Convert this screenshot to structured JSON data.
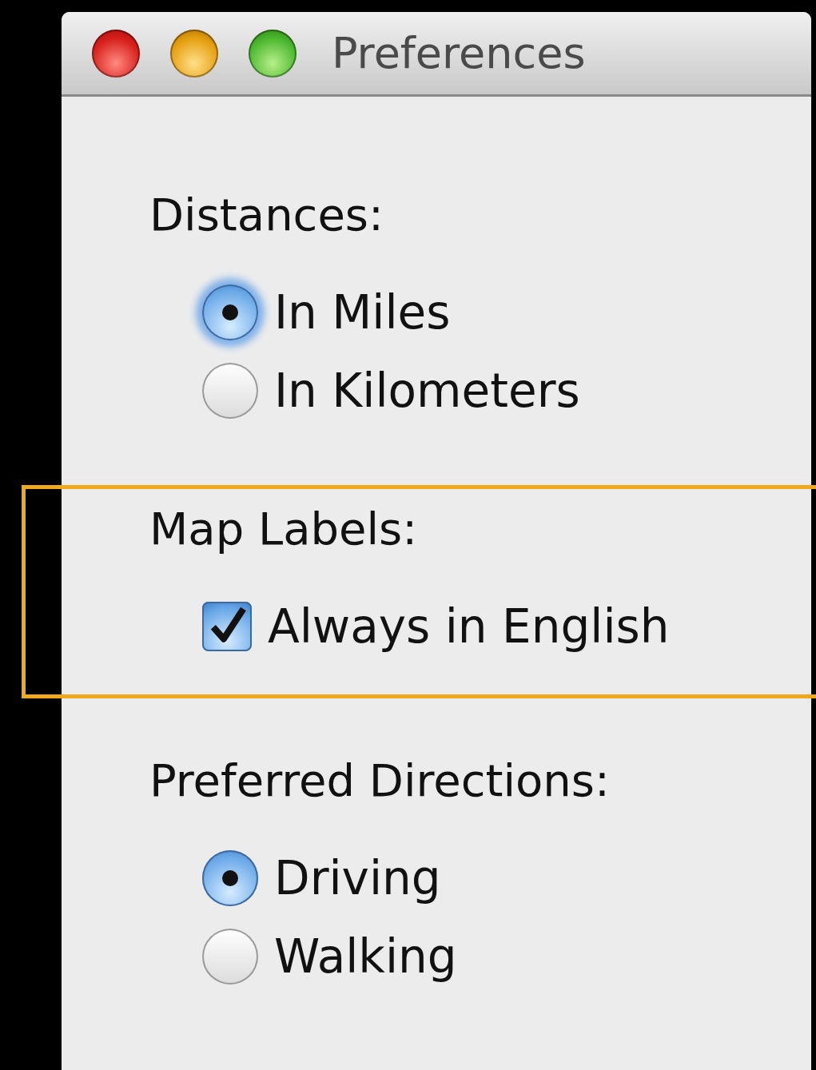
{
  "window": {
    "title": "Preferences"
  },
  "sections": [
    {
      "kind": "radio",
      "heading": "Distances:",
      "highlighted": false,
      "options": [
        {
          "label": "In Miles",
          "selected": true,
          "focused": true
        },
        {
          "label": "In Kilometers",
          "selected": false,
          "focused": false
        }
      ]
    },
    {
      "kind": "checkbox",
      "heading": "Map Labels:",
      "highlighted": true,
      "options": [
        {
          "label": "Always in English",
          "checked": true
        }
      ]
    },
    {
      "kind": "radio",
      "heading": "Preferred Directions:",
      "highlighted": false,
      "options": [
        {
          "label": "Driving",
          "selected": true,
          "focused": false
        },
        {
          "label": "Walking",
          "selected": false,
          "focused": false
        }
      ]
    }
  ]
}
